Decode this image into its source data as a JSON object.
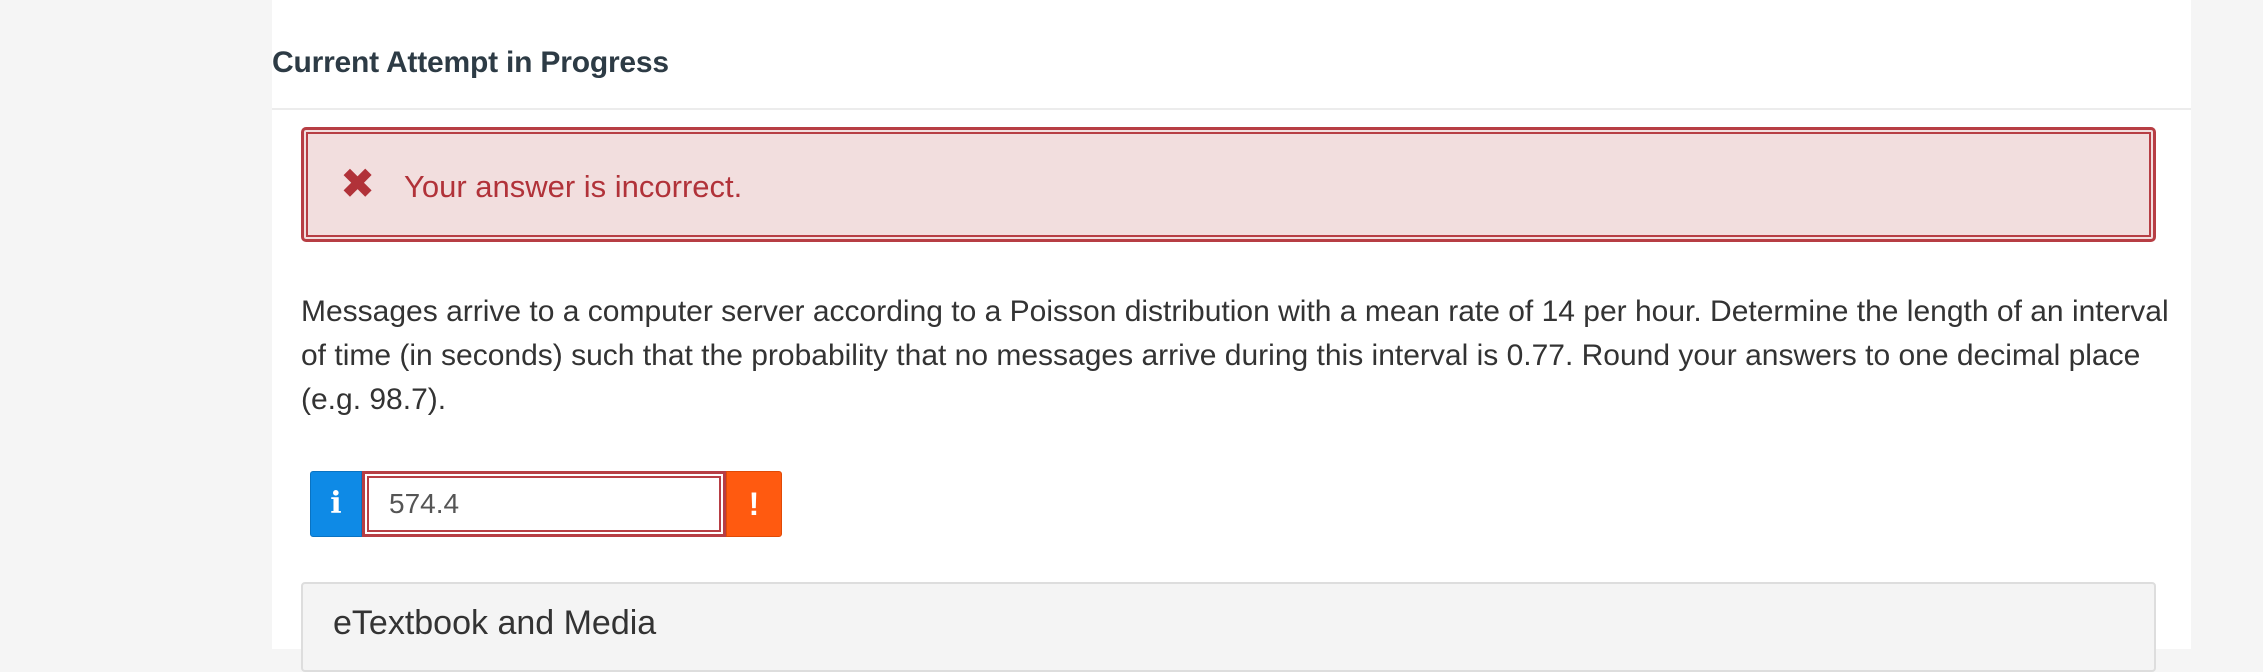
{
  "section": {
    "title": "Current Attempt in Progress"
  },
  "alert": {
    "icon": "close-x-icon",
    "icon_glyph": "✖",
    "message": "Your answer is incorrect.",
    "color": "#b13239",
    "background": "#f2dede"
  },
  "question": {
    "text": "Messages arrive to a computer server according to a Poisson distribution with a mean rate of 14 per hour. Determine the length of an interval of time (in seconds) such that the probability that no messages arrive during this interval is 0.77. Round your answers to one decimal place (e.g. 98.7)."
  },
  "answer": {
    "info_icon": "info-icon",
    "info_glyph": "i",
    "value": "574.4",
    "warning_icon": "exclamation-icon",
    "warning_glyph": "!",
    "info_color": "#0e8ae6",
    "warning_color": "#ff5a10"
  },
  "media": {
    "title": "eTextbook and Media"
  }
}
